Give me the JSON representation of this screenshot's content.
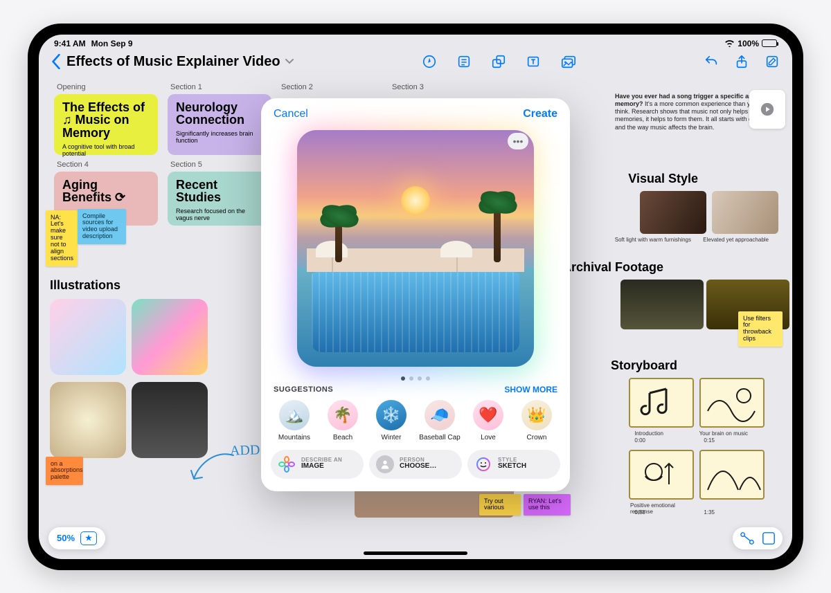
{
  "status": {
    "time": "9:41 AM",
    "date": "Mon Sep 9",
    "battery": "100%"
  },
  "header": {
    "title": "Effects of Music Explainer Video"
  },
  "sections": {
    "opening": "Opening",
    "s1": "Section 1",
    "s2": "Section 2",
    "s3": "Section 3",
    "s4": "Section 4",
    "s5": "Section 5"
  },
  "cards": {
    "opening": {
      "title": "The Effects of ♫ Music on Memory",
      "sub": "A cognitive tool with broad potential"
    },
    "s1": {
      "title": "Neurology Connection",
      "sub": "Significantly increases brain function"
    },
    "s4": {
      "title": "Aging Benefits ⟳",
      "sub": ""
    },
    "s5": {
      "title": "Recent Studies",
      "sub": "Research focused on the vagus nerve"
    }
  },
  "stickies": {
    "na": "NA: Let's make sure not to align sections",
    "compile": "Compile sources for video upload description",
    "filters": "Use filters for throwback clips",
    "tryout": "Try out various",
    "ryan": "RYAN: Let's use this",
    "abs": "on a absorptions palette"
  },
  "blurb": {
    "title": "Have you ever had a song trigger a specific associated memory?",
    "body": "It's a more common experience than you might think. Research shows that music not only helps to recall memories, it helps to form them. It all starts with emotion and the way music affects the brain."
  },
  "panels": {
    "illustrations": "Illustrations",
    "visual": "Visual Style",
    "archival": "Archival Footage",
    "storyboard": "Storyboard",
    "vis_cap1": "Soft light with warm furnishings",
    "vis_cap2": "Elevated yet approachable",
    "sb1a": "Introduction",
    "sb1b": "0:00",
    "sb2a": "Your brain on music",
    "sb2b": "0:15",
    "sb3a": "Positive emotional response",
    "sb3b": "0:50",
    "sb4a": "",
    "sb4b": "1:35"
  },
  "handwriting": "ADD NEW IDEAS",
  "zoom": "50%",
  "modal": {
    "cancel": "Cancel",
    "create": "Create",
    "suggestions_label": "SUGGESTIONS",
    "show_more": "SHOW MORE",
    "items": [
      {
        "name": "Mountains"
      },
      {
        "name": "Beach"
      },
      {
        "name": "Winter"
      },
      {
        "name": "Baseball Cap"
      },
      {
        "name": "Love"
      },
      {
        "name": "Crown"
      }
    ],
    "pills": {
      "describe_k": "DESCRIBE AN",
      "describe_v": "IMAGE",
      "person_k": "PERSON",
      "person_v": "CHOOSE…",
      "style_k": "STYLE",
      "style_v": "SKETCH"
    }
  }
}
